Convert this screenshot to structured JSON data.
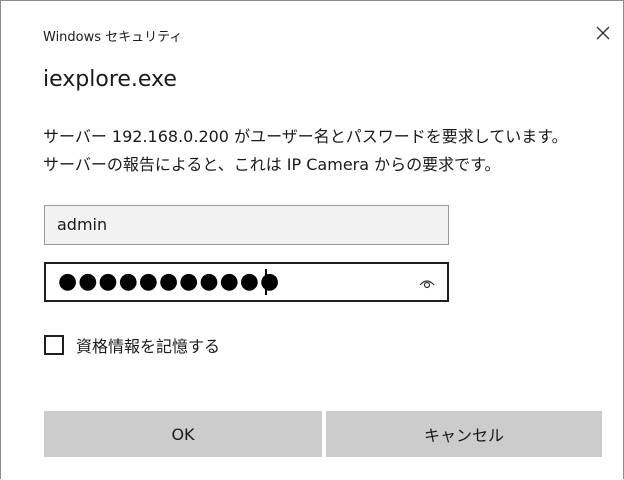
{
  "window": {
    "title": "Windows セキュリティ",
    "app_name": "iexplore.exe"
  },
  "message": {
    "line1": "サーバー 192.168.0.200 がユーザー名とパスワードを要求しています。",
    "line2": "サーバーの報告によると、これは IP Camera からの要求です。"
  },
  "username_field": {
    "value": "admin"
  },
  "password_field": {
    "masked_value": "●●●●●●●●●●●",
    "reveal_icon": "eye-icon"
  },
  "remember": {
    "label": "資格情報を記憶する",
    "checked": false
  },
  "buttons": {
    "ok": "OK",
    "cancel": "キャンセル"
  },
  "icons": {
    "close": "close-icon"
  },
  "colors": {
    "button_bg": "#cccccc",
    "username_bg": "#f2f2f2",
    "border_dark": "#1f1f1f"
  }
}
